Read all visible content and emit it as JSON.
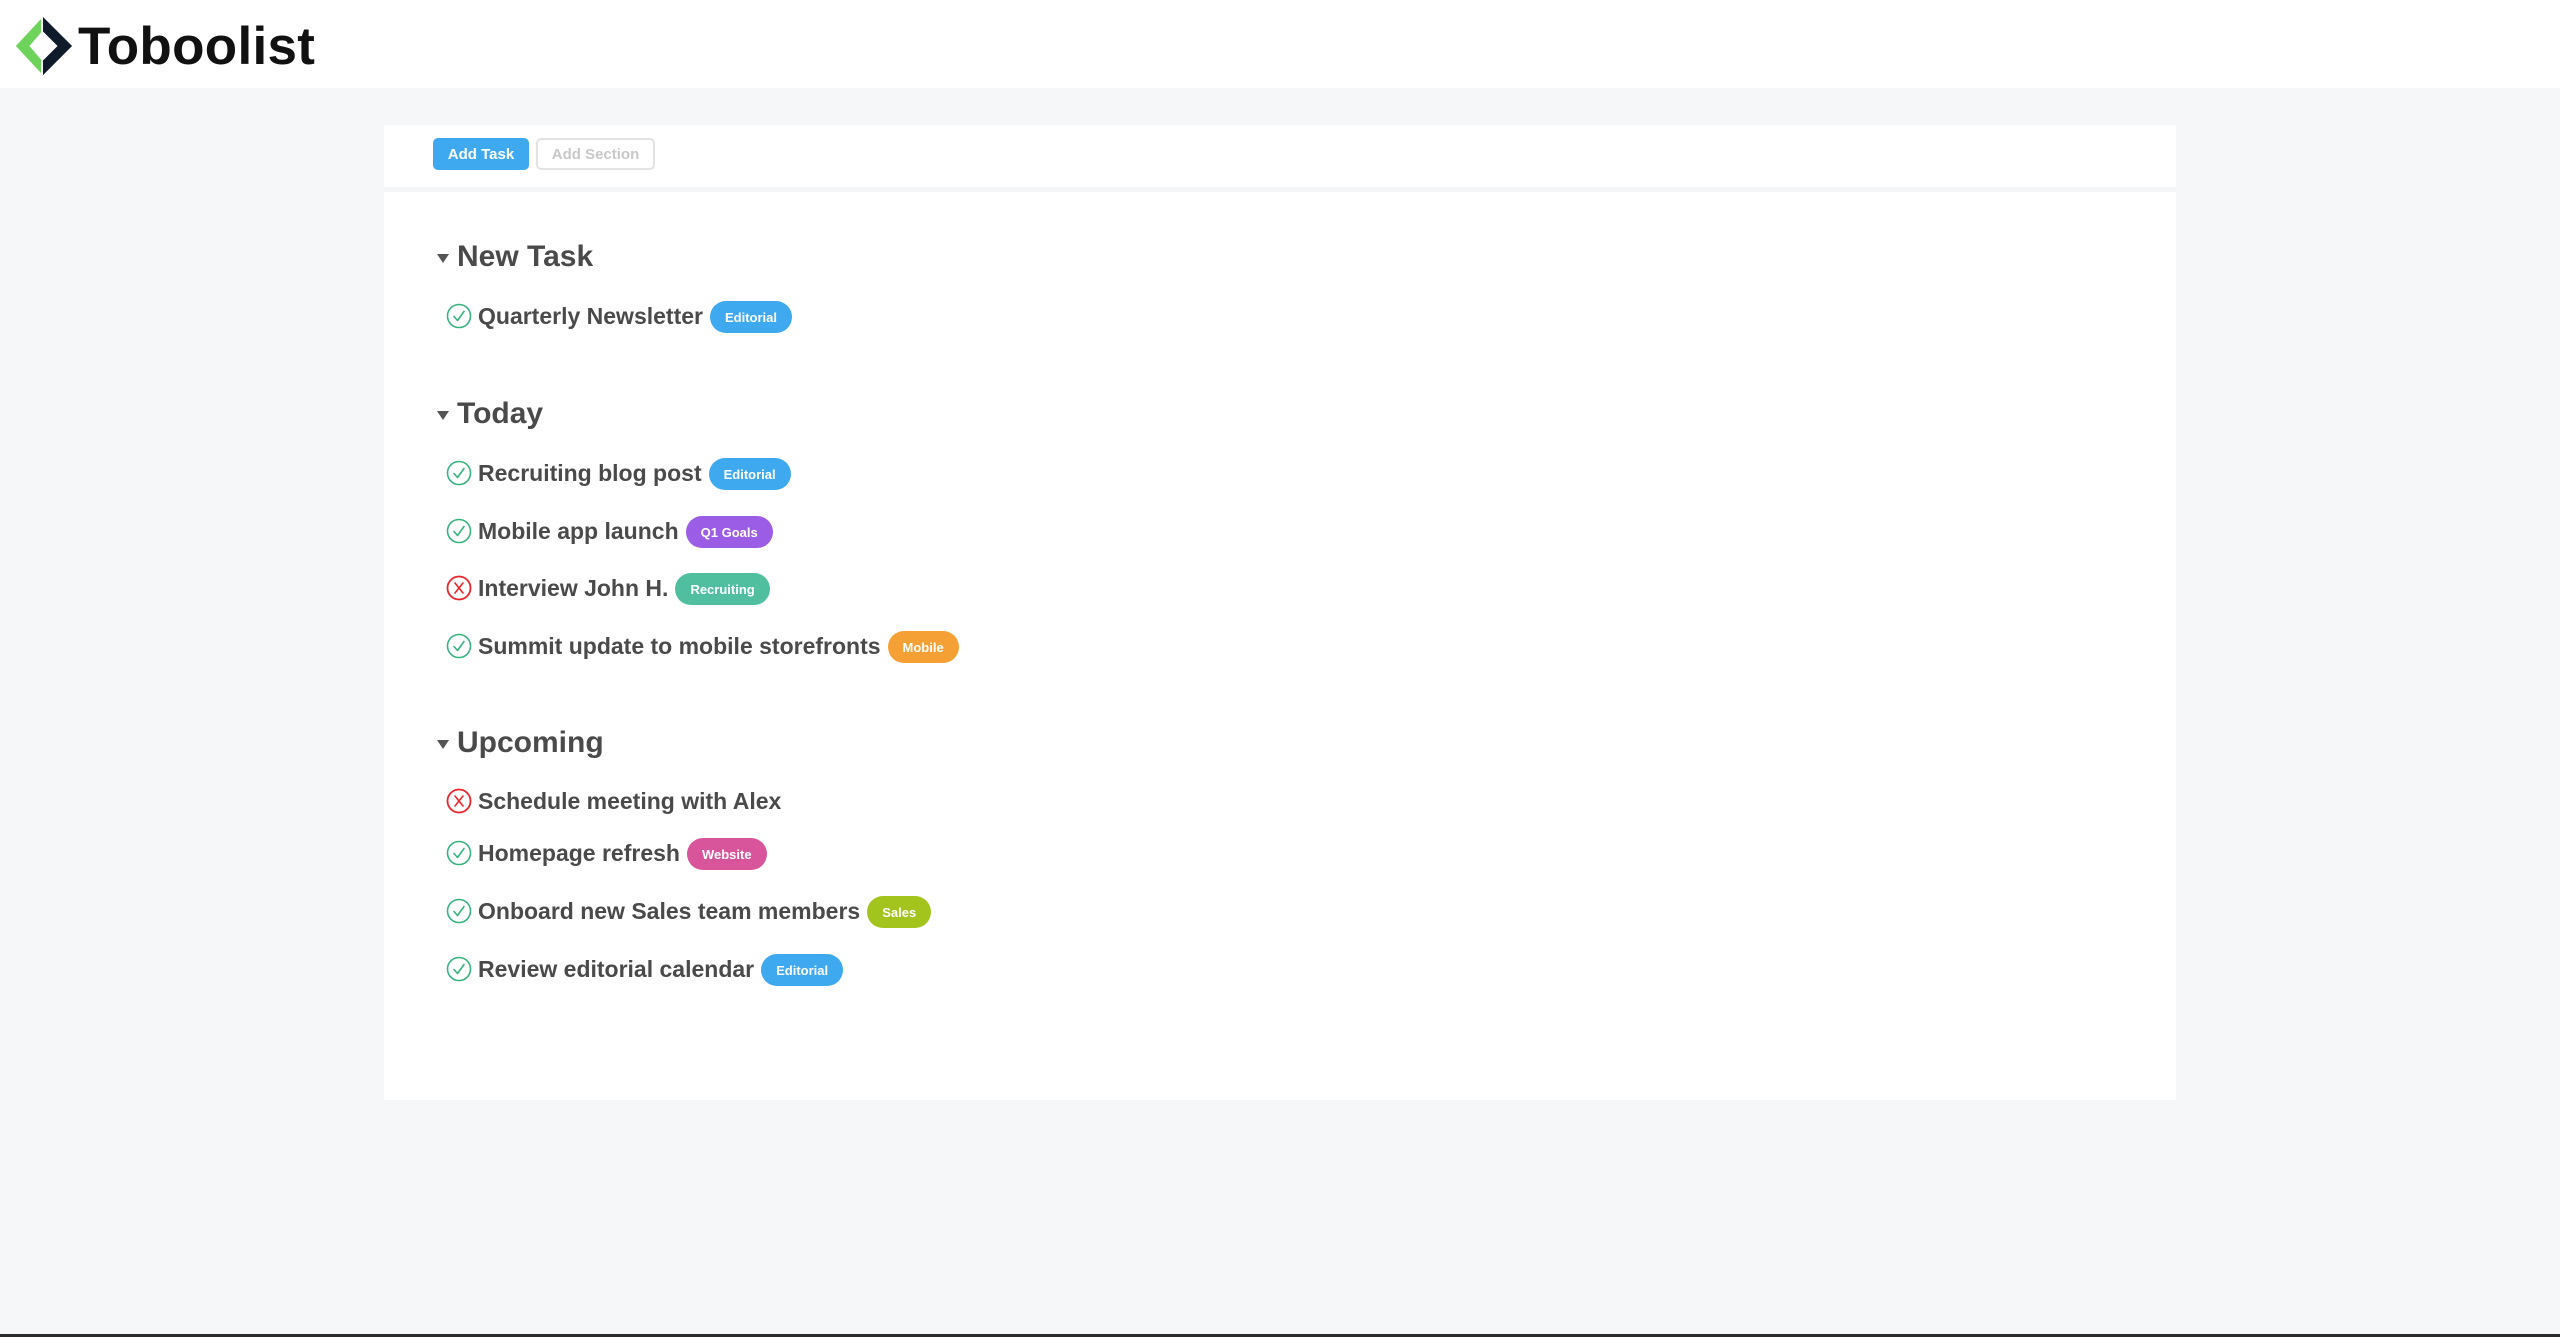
{
  "app": {
    "name": "Toboolist",
    "logo_icon": "diamond-chevron-logo-icon",
    "logo_colors": {
      "left": "#6dd35a",
      "right": "#0f1a2b"
    }
  },
  "toolbar": {
    "add_task_label": "Add Task",
    "add_section_label": "Add Section"
  },
  "colors": {
    "accent": "#3fa9ef",
    "done": "#36b37e",
    "failed": "#e8262b"
  },
  "sections": [
    {
      "title": "New Task",
      "tasks": [
        {
          "name": "Quarterly Newsletter",
          "status": "done",
          "tag": "Editorial",
          "tag_color": "#3fa9ef"
        }
      ]
    },
    {
      "title": "Today",
      "tasks": [
        {
          "name": "Recruiting blog post",
          "status": "done",
          "tag": "Editorial",
          "tag_color": "#3fa9ef"
        },
        {
          "name": "Mobile app launch",
          "status": "done",
          "tag": "Q1 Goals",
          "tag_color": "#9b5de5"
        },
        {
          "name": "Interview John H.",
          "status": "failed",
          "tag": "Recruiting",
          "tag_color": "#4fbfa0"
        },
        {
          "name": "Summit update to mobile storefronts",
          "status": "done",
          "tag": "Mobile",
          "tag_color": "#f5a035"
        }
      ]
    },
    {
      "title": "Upcoming",
      "tasks": [
        {
          "name": "Schedule meeting with Alex",
          "status": "failed",
          "tag": "",
          "tag_color": ""
        },
        {
          "name": "Homepage refresh",
          "status": "done",
          "tag": "Website",
          "tag_color": "#d9559b"
        },
        {
          "name": "Onboard new Sales team members",
          "status": "done",
          "tag": "Sales",
          "tag_color": "#a3c41d"
        },
        {
          "name": "Review editorial calendar",
          "status": "done",
          "tag": "Editorial",
          "tag_color": "#3fa9ef"
        }
      ]
    }
  ]
}
